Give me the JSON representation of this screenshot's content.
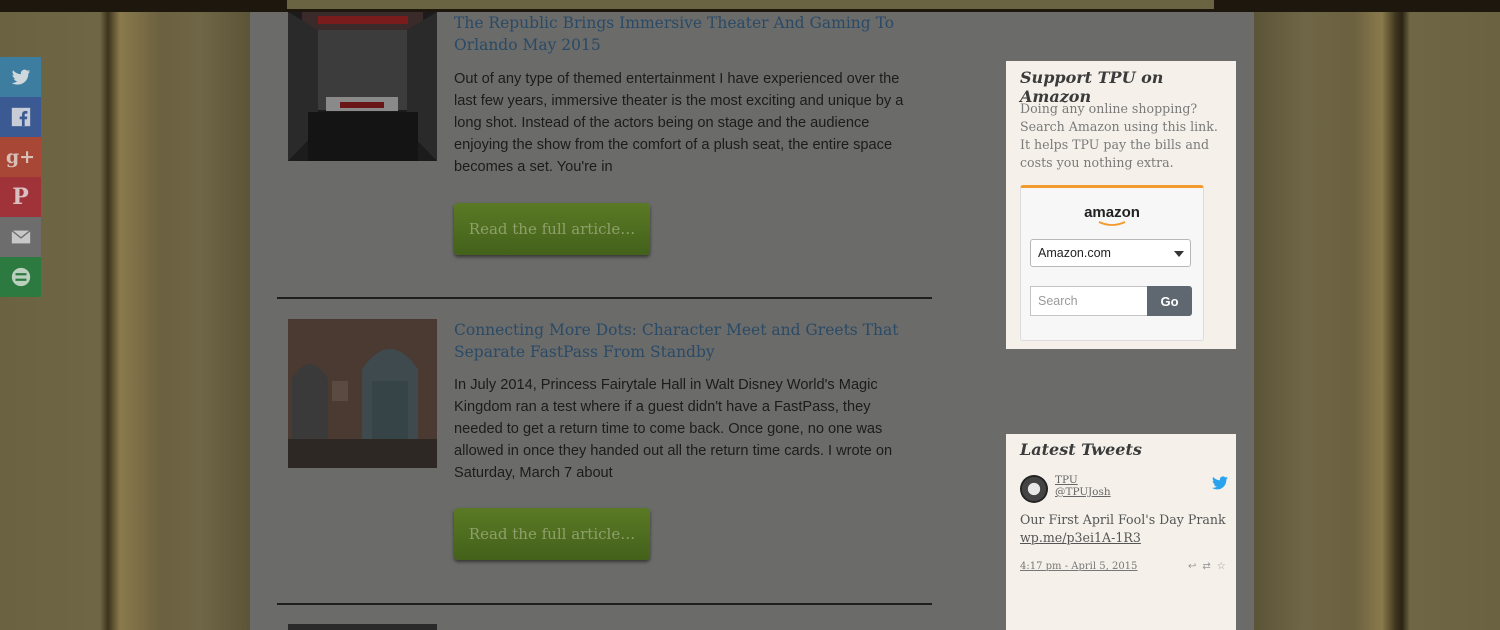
{
  "share": {
    "items": [
      {
        "label": "Twitter",
        "color": "#3d7ea0"
      },
      {
        "label": "Facebook",
        "color": "#3b5a94"
      },
      {
        "label": "Google+",
        "color": "#a84735"
      },
      {
        "label": "Pinterest",
        "color": "#a0323a"
      },
      {
        "label": "Email",
        "color": "#6d6d6d"
      },
      {
        "label": "More",
        "color": "#2c7a3f"
      }
    ]
  },
  "articles": [
    {
      "title": "The Republic Brings Immersive Theater And Gaming To Orlando May 2015",
      "excerpt": "Out of any type of themed entertainment I have experienced over the last few years, immersive theater is the most exciting and unique by a long shot. Instead of the actors being on stage and the audience enjoying the show from the comfort of a plush seat, the entire space becomes a set. You're in",
      "button": "Read the full article…"
    },
    {
      "title": "Connecting More Dots: Character Meet and Greets That Separate FastPass From Standby",
      "excerpt": "In July 2014, Princess Fairytale Hall in Walt Disney World's Magic Kingdom ran a test where if a guest didn't have a FastPass, they needed to get a return time to come back. Once gone, no one was allowed in once they handed out all the return time cards. I wrote on Saturday, March 7 about",
      "button": "Read the full article…"
    }
  ],
  "amazon_widget": {
    "title": "Support TPU on Amazon",
    "text": "Doing any online shopping? Search Amazon using this link. It helps TPU pay the bills and costs you nothing extra.",
    "logo": "amazon",
    "store_select": "Amazon.com",
    "search_placeholder": "Search",
    "go_label": "Go"
  },
  "tweets_widget": {
    "title": "Latest Tweets",
    "name": "TPU",
    "handle": "@TPUJosh",
    "tweet_text": "Our First April Fool's Day Prank",
    "tweet_link": "wp.me/p3ei1A-1R3",
    "timestamp": "4:17 pm - April 5, 2015"
  }
}
